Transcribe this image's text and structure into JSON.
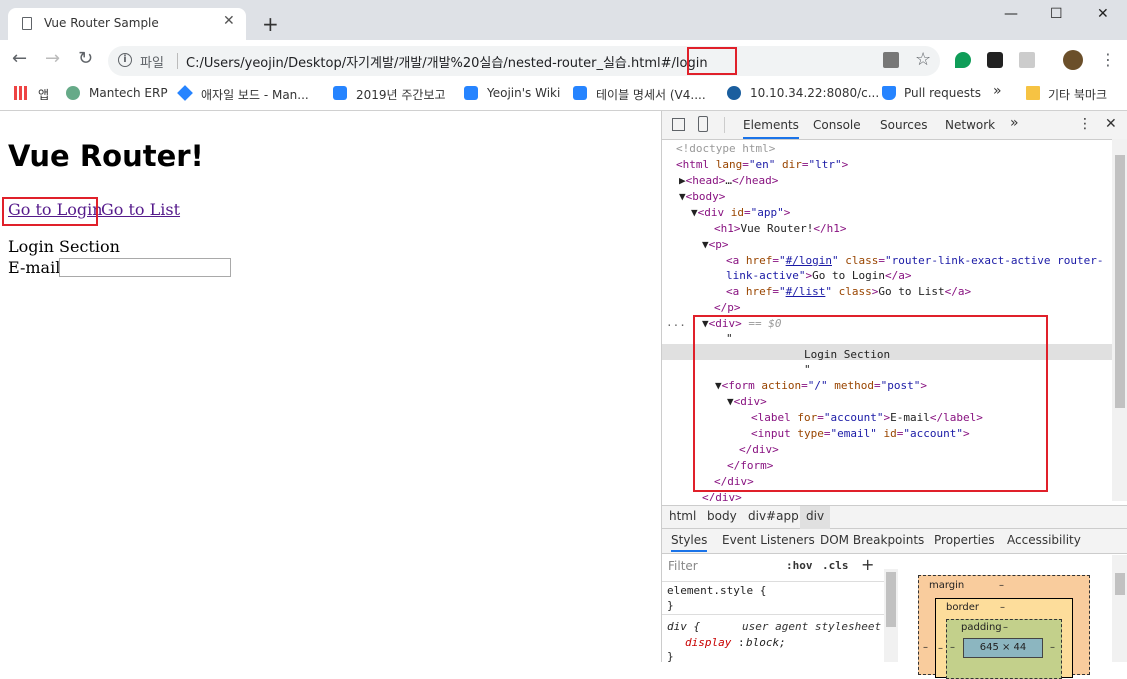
{
  "browser": {
    "tab_title": "Vue Router Sample",
    "tab_close": "✕",
    "new_tab": "+",
    "window_minimize": "—",
    "window_maximize": "☐",
    "window_close": "✕",
    "back": "←",
    "forward": "→",
    "reload": "↻",
    "info": "i",
    "file_label": "파일",
    "url": "C:/Users/yeojin/Desktop/자기계발/개발/개발%20실습/nested-router_실습.html#/login",
    "star": "☆",
    "more": "⋮",
    "ext_chevron": "»"
  },
  "bookmarks": [
    {
      "label": "앱",
      "icon": "apps-grid-icon"
    },
    {
      "label": "Mantech ERP",
      "icon": "globe-icon"
    },
    {
      "label": "애자일 보드 - Man...",
      "icon": "jira-icon"
    },
    {
      "label": "2019년 주간보고",
      "icon": "confluence-icon"
    },
    {
      "label": "Yeojin's Wiki",
      "icon": "confluence-icon"
    },
    {
      "label": "테이블 명세서 (V4....",
      "icon": "confluence-icon"
    },
    {
      "label": "10.10.34.22:8080/c...",
      "icon": "spiral-icon"
    },
    {
      "label": "Pull requests",
      "icon": "bitbucket-icon"
    },
    {
      "label": "»",
      "icon": ""
    },
    {
      "label": "기타 북마크",
      "icon": "folder-icon"
    }
  ],
  "page": {
    "heading": "Vue Router!",
    "link_login": "Go to Login",
    "link_list": "Go to List",
    "section_text": "Login Section",
    "email_label": "E-mail"
  },
  "devtools": {
    "tabs": [
      "Elements",
      "Console",
      "Sources",
      "Network",
      "»"
    ],
    "menu": "⋮",
    "close": "✕",
    "dom": {
      "doctype": "<!doctype html>",
      "html_open": "html",
      "lang_attr": "lang",
      "lang_val": "\"en\"",
      "dir_attr": "dir",
      "dir_val": "\"ltr\"",
      "head": "head",
      "head_ellipsis": "…",
      "body": "body",
      "div_tag": "div",
      "id_attr": "id",
      "id_val": "\"app\"",
      "h1_tag": "h1",
      "h1_text": "Vue Router!",
      "p_tag": "p",
      "a_tag": "a",
      "href_attr": "href",
      "href_login": "#/login",
      "class_attr": "class",
      "class_val_1": "\"router-link-exact-active router-",
      "class_val_2": "link-active\"",
      "a1_text": "Go to Login",
      "href_list": "#/list",
      "a2_text": "Go to List",
      "selected_marker": "== $0",
      "quote": "\"",
      "text_node": "Login Section",
      "form_tag": "form",
      "action_attr": "action",
      "action_val": "\"/\"",
      "method_attr": "method",
      "method_val": "\"post\"",
      "label_tag": "label",
      "for_attr": "for",
      "for_val": "\"account\"",
      "label_text": "E-mail",
      "input_tag": "input",
      "type_attr": "type",
      "type_val": "\"email\"",
      "account_val": "\"account\"",
      "gutter": "..."
    },
    "breadcrumbs": [
      "html",
      "body",
      "div#app",
      "div"
    ],
    "subtabs": [
      "Styles",
      "Event Listeners",
      "DOM Breakpoints",
      "Properties",
      "Accessibility"
    ],
    "filter_placeholder": "Filter",
    "hov": ":hov",
    "cls": ".cls",
    "plus": "+",
    "css": {
      "element_style": "element.style {",
      "close_brace": "}",
      "div_rule": "div {",
      "ua_label": "user agent stylesheet",
      "display_prop": "display",
      "display_val": "block;"
    },
    "box_model": {
      "margin": "margin",
      "border": "border",
      "padding": "padding",
      "dash": "–",
      "content_size": "645 × 44"
    }
  },
  "colors": {
    "highlight_red": "#e0202a",
    "link_visited": "#551a8b",
    "tab_active_blue": "#1a73e8"
  }
}
